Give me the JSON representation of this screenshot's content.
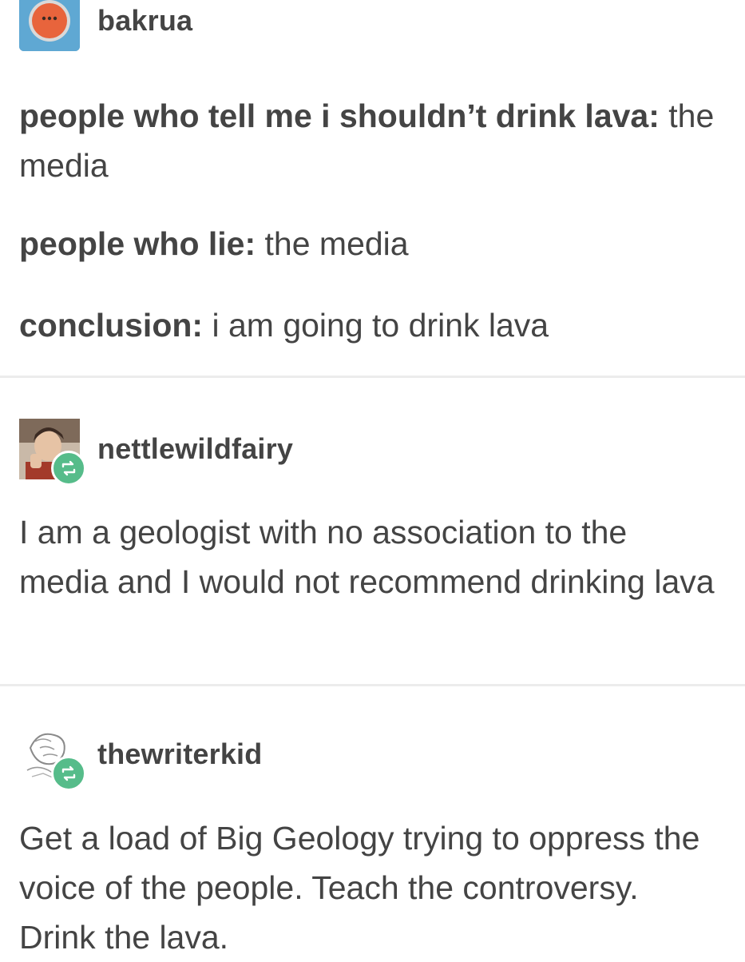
{
  "posts": [
    {
      "username": "bakrua",
      "avatar_icon": "orange-circle-avatar",
      "lines": [
        {
          "label": "people who tell me i shouldn’t drink lava:",
          "text": " the media"
        },
        {
          "label": "people who lie:",
          "text": " the media"
        },
        {
          "label": "conclusion:",
          "text": " i am going to drink lava"
        }
      ]
    },
    {
      "username": "nettlewildfairy",
      "avatar_icon": "photo-avatar",
      "reblog_icon": "reblog-icon",
      "body": "I am a geologist with no association to the media and I would not recommend drinking lava"
    },
    {
      "username": "thewriterkid",
      "avatar_icon": "sketch-avatar",
      "reblog_icon": "reblog-icon",
      "body": "Get a load of Big Geology trying to oppress the voice of the people. Teach the controversy. Drink the lava."
    }
  ],
  "colors": {
    "text": "#444444",
    "divider": "#ececec",
    "reblog_badge": "#56bc8a",
    "avatar_bg": "#5fa8d3",
    "avatar_circle": "#e8643c"
  }
}
